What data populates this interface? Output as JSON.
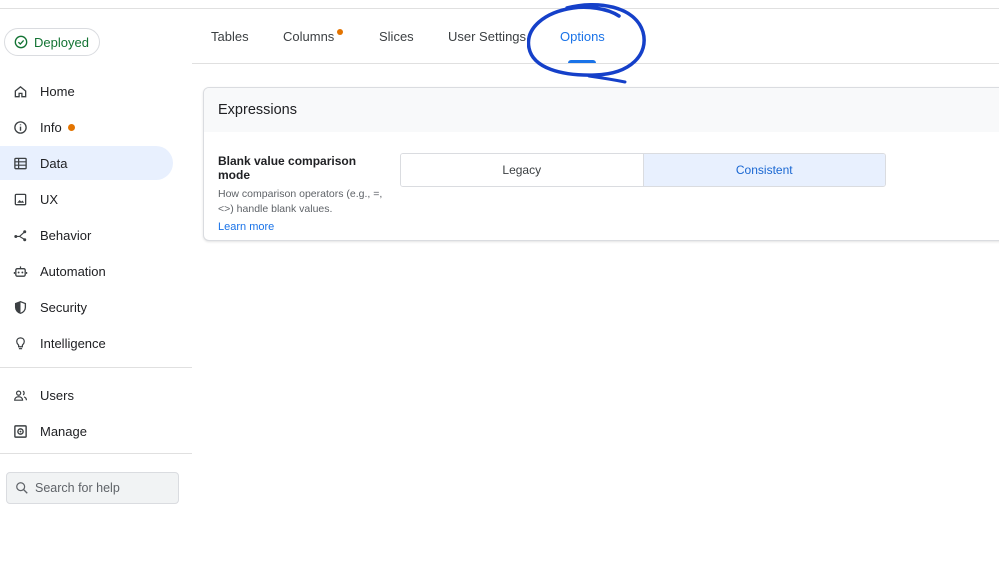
{
  "status": {
    "label": "Deployed",
    "color": "#137333"
  },
  "sidebar": {
    "items": [
      {
        "label": "Home",
        "icon": "home-icon"
      },
      {
        "label": "Info",
        "icon": "info-icon",
        "badge": true
      },
      {
        "label": "Data",
        "icon": "data-table-icon",
        "active": true
      },
      {
        "label": "UX",
        "icon": "image-icon"
      },
      {
        "label": "Behavior",
        "icon": "behavior-icon"
      },
      {
        "label": "Automation",
        "icon": "robot-icon"
      },
      {
        "label": "Security",
        "icon": "shield-icon"
      },
      {
        "label": "Intelligence",
        "icon": "lightbulb-icon"
      },
      {
        "label": "Users",
        "icon": "users-icon"
      },
      {
        "label": "Manage",
        "icon": "manage-icon"
      }
    ]
  },
  "search": {
    "placeholder": "Search for help"
  },
  "tabs": [
    {
      "label": "Tables"
    },
    {
      "label": "Columns",
      "badge": true
    },
    {
      "label": "Slices"
    },
    {
      "label": "User Settings"
    },
    {
      "label": "Options",
      "active": true
    }
  ],
  "card": {
    "title": "Expressions",
    "setting": {
      "title": "Blank value comparison mode",
      "description": "How comparison operators (e.g., =, <>) handle blank values.",
      "link": "Learn more",
      "options": [
        "Legacy",
        "Consistent"
      ],
      "selected": "Consistent"
    }
  },
  "colors": {
    "accent": "#1a73e8",
    "badge": "#e37400",
    "annotation": "#1540c9"
  }
}
